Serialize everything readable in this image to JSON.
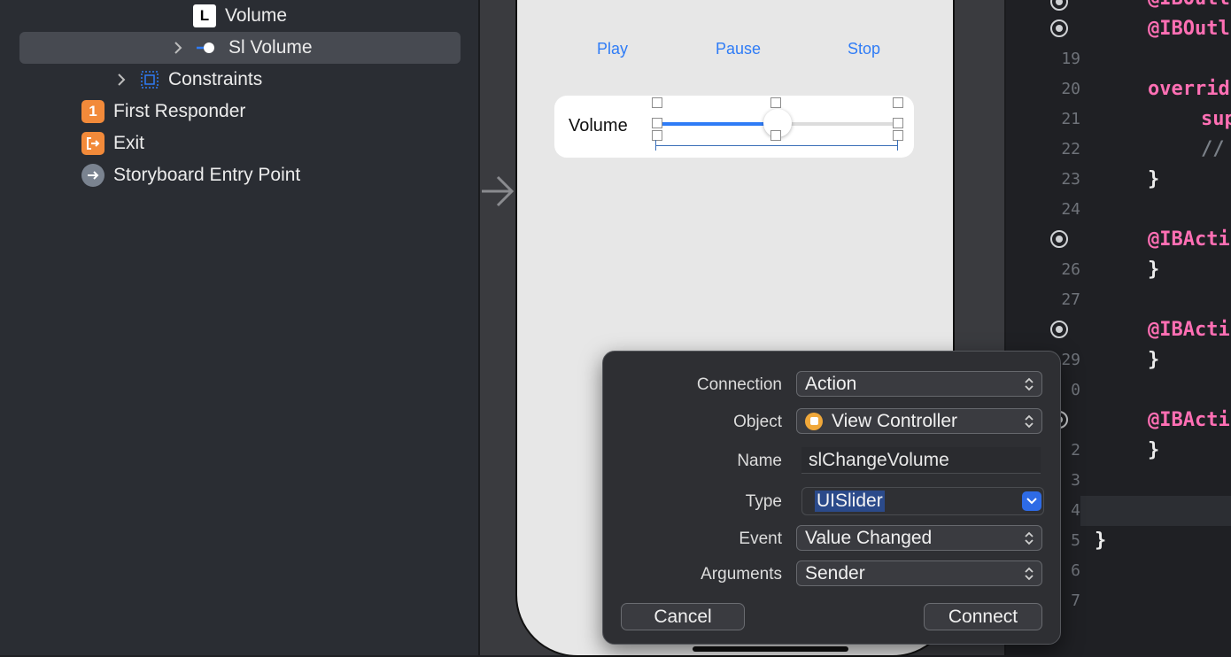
{
  "outline": {
    "items": [
      {
        "label": "Volume",
        "icon": "label-icon",
        "badge": "L"
      },
      {
        "label": "Sl Volume",
        "icon": "slider-icon"
      },
      {
        "label": "Constraints",
        "icon": "constraints-icon"
      },
      {
        "label": "First Responder",
        "icon": "first-responder-icon",
        "badge": "1"
      },
      {
        "label": "Exit",
        "icon": "exit-icon"
      },
      {
        "label": "Storyboard Entry Point",
        "icon": "entry-point-icon"
      }
    ]
  },
  "canvas": {
    "buttons": {
      "play": "Play",
      "pause": "Pause",
      "stop": "Stop"
    },
    "volume_label": "Volume",
    "slider_value": 0.5,
    "accent_color": "#2f7cf6"
  },
  "editor": {
    "line_numbers": [
      "19",
      "20",
      "21",
      "22",
      "23",
      "24",
      "26",
      "27",
      "29",
      "0",
      "2",
      "3",
      "4",
      "5",
      "6",
      "7"
    ],
    "lines": {
      "outlet_a": "@IBOutl",
      "outlet_b": "@IBOutl",
      "override": "overrid",
      "super": "sup",
      "comment": "//",
      "brace": "}",
      "action_a": "@IBActi",
      "action_b": "@IBActi",
      "action_c": "@IBActi",
      "closing": "}"
    },
    "keyword_color": "#ff6fb4"
  },
  "popover": {
    "connection": {
      "label": "Connection",
      "value": "Action"
    },
    "object": {
      "label": "Object",
      "value": "View Controller"
    },
    "name": {
      "label": "Name",
      "value": "slChangeVolume"
    },
    "type": {
      "label": "Type",
      "value": "UISlider"
    },
    "event": {
      "label": "Event",
      "value": "Value Changed"
    },
    "arguments": {
      "label": "Arguments",
      "value": "Sender"
    },
    "cancel_label": "Cancel",
    "connect_label": "Connect"
  }
}
